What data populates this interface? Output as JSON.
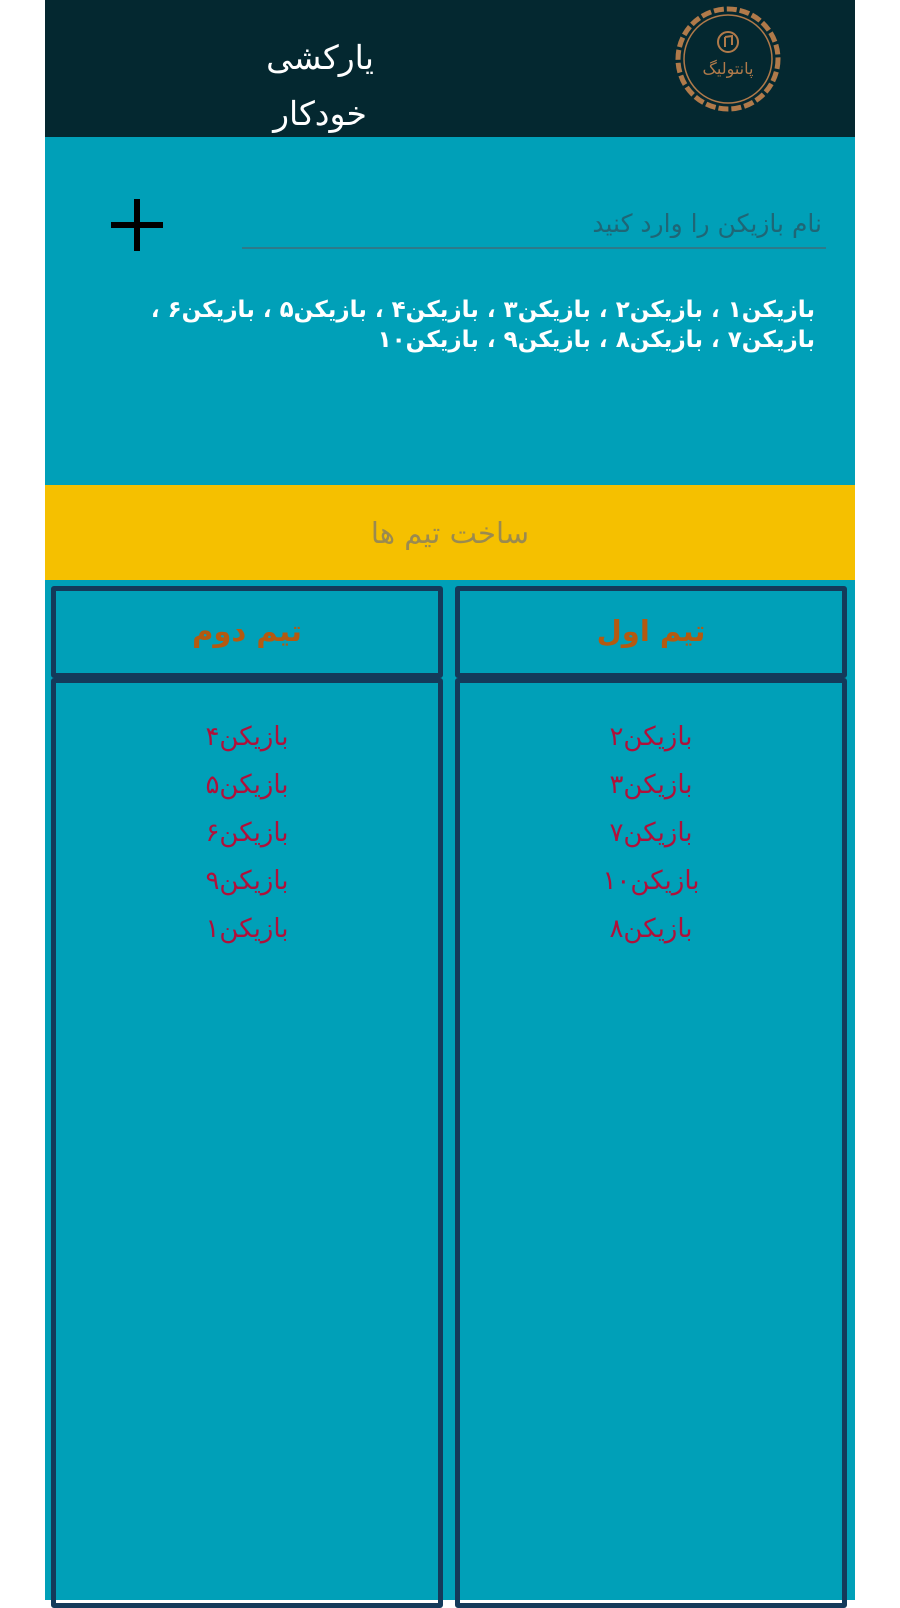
{
  "header": {
    "title": "یارکشی خودکار",
    "logo_text": "پانتولیگ"
  },
  "input": {
    "placeholder": "نام بازیکن را وارد کنید",
    "value": "",
    "add_icon": "plus-icon"
  },
  "players_summary": "بازیکن۱ ، بازیکن۲ ، بازیکن۳ ، بازیکن۴ ، بازیکن۵ ، بازیکن۶ ، بازیکن۷ ، بازیکن۸ ، بازیکن۹ ، بازیکن۱۰",
  "make_teams_label": "ساخت تیم ها",
  "teams": [
    {
      "title": "تیم اول",
      "members": [
        "بازیکن۲",
        "بازیکن۳",
        "بازیکن۷",
        "بازیکن۱۰",
        "بازیکن۸"
      ]
    },
    {
      "title": "تیم دوم",
      "members": [
        "بازیکن۴",
        "بازیکن۵",
        "بازیکن۶",
        "بازیکن۹",
        "بازیکن۱"
      ]
    }
  ],
  "colors": {
    "header_bg": "#042830",
    "main_bg": "#00a0b8",
    "button_bg": "#f5c000",
    "team_title": "#b45a10",
    "member_text": "#b0103a",
    "panel_border": "#143a5a",
    "logo_color": "#b07a4a"
  }
}
